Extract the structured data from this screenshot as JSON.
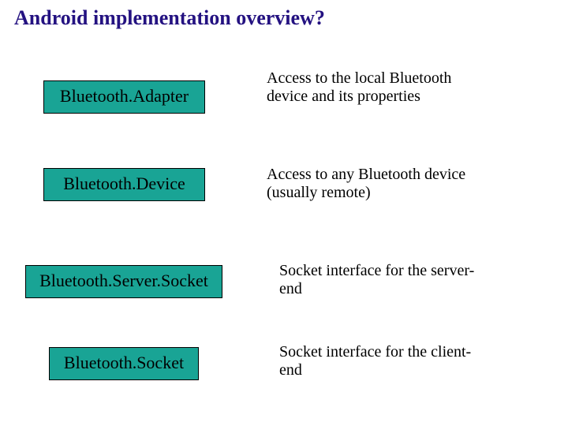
{
  "title": "Android implementation overview?",
  "rows": [
    {
      "label": "Bluetooth.Adapter",
      "desc": "Access to the local Bluetooth device and its properties"
    },
    {
      "label": "Bluetooth.Device",
      "desc": "Access to any Bluetooth device (usually remote)"
    },
    {
      "label": "Bluetooth.Server.Socket",
      "desc": "Socket interface for the server-end"
    },
    {
      "label": "Bluetooth.Socket",
      "desc": "Socket interface for the client-end"
    }
  ]
}
